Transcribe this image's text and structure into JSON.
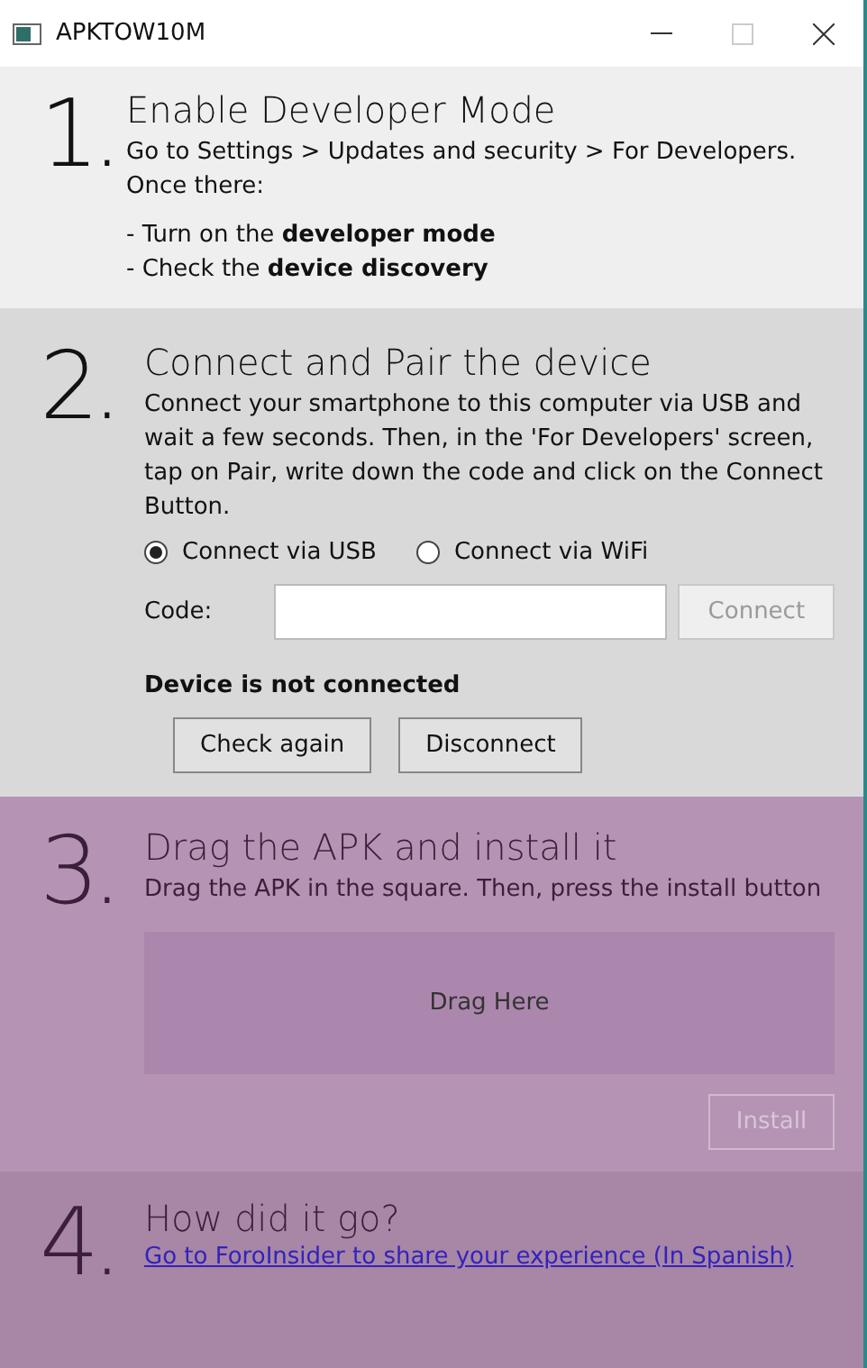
{
  "window": {
    "title": "APKTOW10M"
  },
  "steps": [
    {
      "kind": "instructions",
      "number": "1.",
      "title": "Enable Developer Mode",
      "text": "Go to Settings > Updates and security > For Developers. Once there:",
      "bullets": [
        "- Turn on the **developer mode**",
        "- Check the **device discovery**"
      ]
    },
    {
      "kind": "connect",
      "number": "2.",
      "title": "Connect and Pair the device",
      "text": "Connect your smartphone to this computer via USB and wait a few seconds. Then, in the 'For Developers' screen, tap on Pair, write down the code and click on the Connect Button.",
      "options": [
        {
          "label": "Connect via USB",
          "selected": true
        },
        {
          "label": "Connect via WiFi",
          "selected": false
        }
      ],
      "code_label": "Code:",
      "connect_button": {
        "label": "Connect",
        "disabled": true
      },
      "status": "Device is not connected",
      "buttons": [
        {
          "label": "Check again",
          "disabled": false
        },
        {
          "label": "Disconnect",
          "disabled": false
        }
      ]
    },
    {
      "kind": "install",
      "number": "3.",
      "title": "Drag the APK and install it",
      "text": "Drag the APK in the square. Then, press the install button",
      "drop_zone": "Drag Here",
      "install_button": {
        "label": "Install",
        "disabled": true
      }
    },
    {
      "kind": "feedback",
      "number": "4.",
      "title": "How did it go?",
      "link": "Go to ForoInsider to share your experience (In Spanish)"
    }
  ]
}
